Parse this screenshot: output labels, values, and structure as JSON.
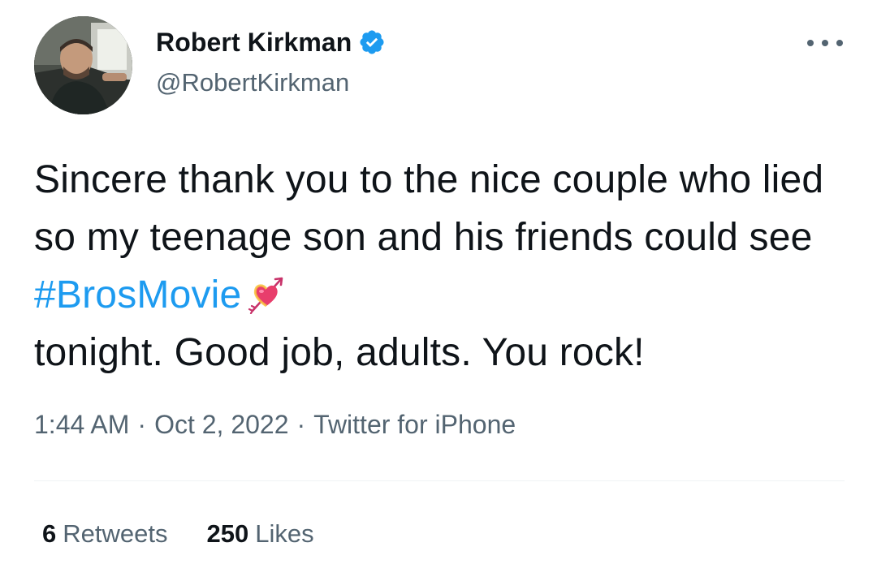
{
  "author": {
    "display_name": "Robert Kirkman",
    "handle": "@RobertKirkman",
    "verified": true,
    "verified_color": "#1d9bf0"
  },
  "tweet": {
    "text_before": "Sincere thank you to the nice couple who lied so my teenage son and his friends could see ",
    "hashtag": "#BrosMovie",
    "emoji": "heart-with-arrow-emoji",
    "text_after": "tonight. Good job, adults. You rock!"
  },
  "meta": {
    "time": "1:44 AM",
    "date": "Oct 2, 2022",
    "separator": "·",
    "source": "Twitter for iPhone"
  },
  "stats": {
    "retweets_count": "6",
    "retweets_label": "Retweets",
    "likes_count": "250",
    "likes_label": "Likes"
  },
  "colors": {
    "link": "#1d9bf0",
    "secondary_text": "#536471",
    "primary_text": "#0f1419"
  }
}
